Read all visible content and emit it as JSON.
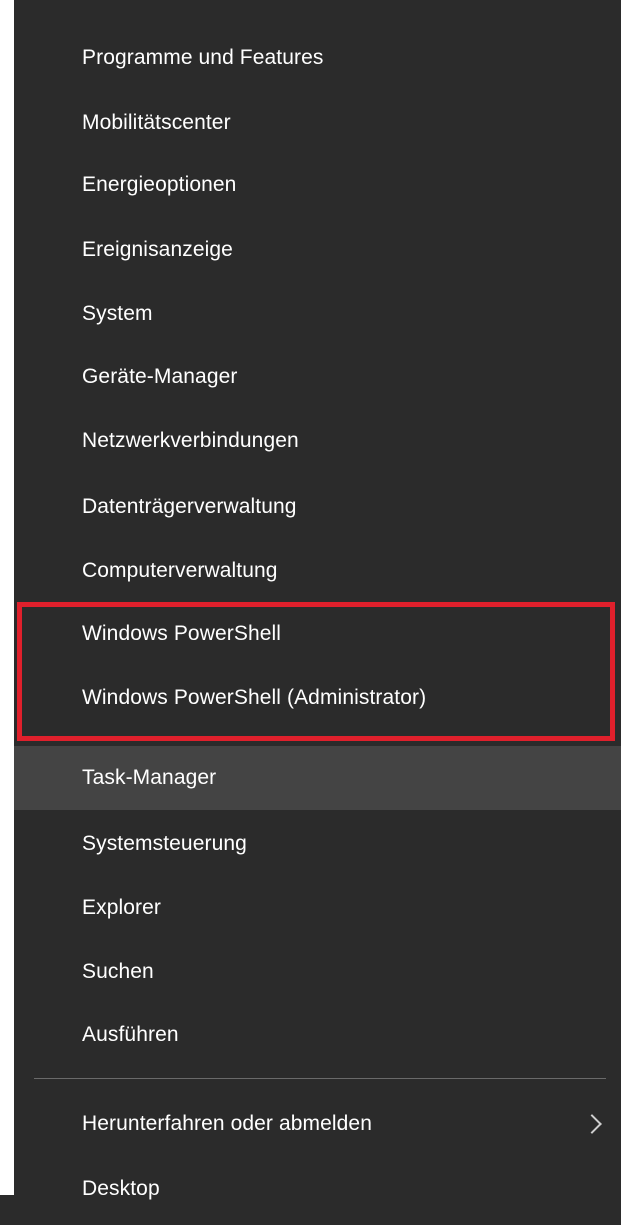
{
  "menu": {
    "items": [
      {
        "label": "Programme und Features"
      },
      {
        "label": "Mobilitätscenter"
      },
      {
        "label": "Energieoptionen"
      },
      {
        "label": "Ereignisanzeige"
      },
      {
        "label": "System"
      },
      {
        "label": "Geräte-Manager"
      },
      {
        "label": "Netzwerkverbindungen"
      },
      {
        "label": "Datenträgerverwaltung"
      },
      {
        "label": "Computerverwaltung"
      },
      {
        "label": "Windows PowerShell"
      },
      {
        "label": "Windows PowerShell (Administrator)"
      },
      {
        "label": "Task-Manager"
      },
      {
        "label": "Systemsteuerung"
      },
      {
        "label": "Explorer"
      },
      {
        "label": "Suchen"
      },
      {
        "label": "Ausführen"
      },
      {
        "label": "Herunterfahren oder abmelden"
      },
      {
        "label": "Desktop"
      }
    ],
    "highlighted_item": "Task-Manager",
    "submenu_icon": "chevron-right-icon"
  },
  "colors": {
    "menu_background": "#2b2b2b",
    "hover_background": "#444444",
    "text": "#ffffff",
    "annotation_border": "#e0202c",
    "separator": "#6a6a6a"
  }
}
